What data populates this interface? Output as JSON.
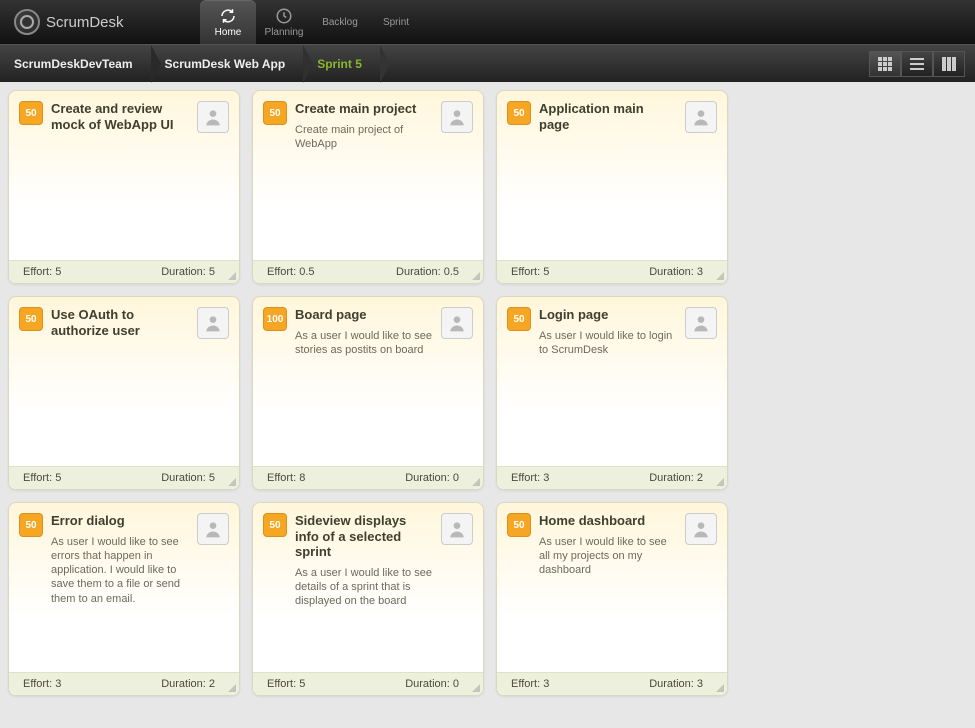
{
  "app": {
    "title": "ScrumDesk"
  },
  "nav": {
    "tabs": [
      {
        "label": "Home",
        "active": true
      },
      {
        "label": "Planning",
        "active": false
      },
      {
        "label": "Backlog",
        "active": false
      },
      {
        "label": "Sprint",
        "active": false
      }
    ]
  },
  "breadcrumb": {
    "items": [
      {
        "label": "ScrumDeskDevTeam",
        "active": false
      },
      {
        "label": "ScrumDesk Web App",
        "active": false
      },
      {
        "label": "Sprint 5",
        "active": true
      }
    ]
  },
  "labels": {
    "effort": "Effort:",
    "duration": "Duration:"
  },
  "cards": [
    {
      "badge": "50",
      "title": "Create and review mock of WebApp UI",
      "desc": "",
      "effort": "5",
      "duration": "5"
    },
    {
      "badge": "50",
      "title": "Create main project",
      "desc": "Create main project of WebApp",
      "effort": "0.5",
      "duration": "0.5"
    },
    {
      "badge": "50",
      "title": "Application main page",
      "desc": "",
      "effort": "5",
      "duration": "3"
    },
    {
      "badge": "50",
      "title": "Use OAuth to authorize user",
      "desc": "",
      "effort": "5",
      "duration": "5"
    },
    {
      "badge": "100",
      "title": "Board page",
      "desc": "As a user I would like to see stories as postits on board",
      "effort": "8",
      "duration": "0"
    },
    {
      "badge": "50",
      "title": "Login page",
      "desc": "As user I would like to login to ScrumDesk",
      "effort": "3",
      "duration": "2"
    },
    {
      "badge": "50",
      "title": "Error dialog",
      "desc": "As user I would like to see errors that happen in application. I would like to save them to a file or send them to an email.",
      "effort": "3",
      "duration": "2"
    },
    {
      "badge": "50",
      "title": "Sideview displays info of a selected sprint",
      "desc": "As a user I would like to see details of a sprint that is displayed on the board",
      "effort": "5",
      "duration": "0"
    },
    {
      "badge": "50",
      "title": "Home dashboard",
      "desc": "As user I would like to see all my projects on my dashboard",
      "effort": "3",
      "duration": "3"
    }
  ]
}
